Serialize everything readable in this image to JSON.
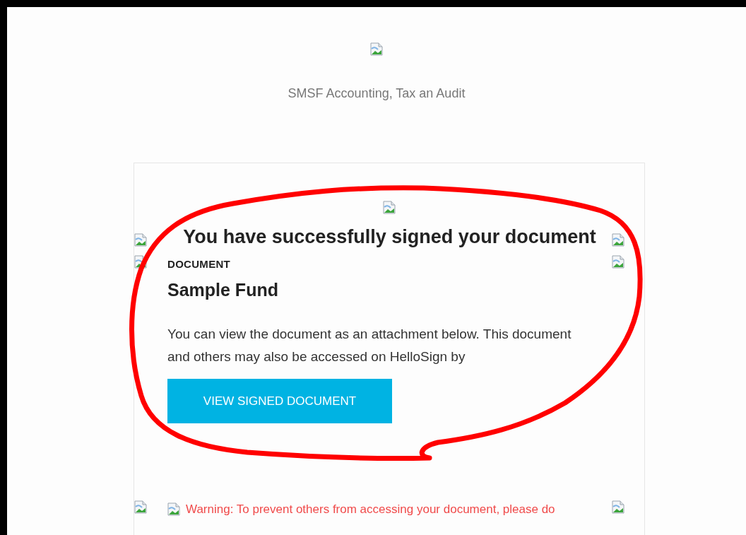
{
  "header": {
    "brand": "SMSF Accounting, Tax an Audit"
  },
  "card": {
    "heading": "You have successfully signed your document",
    "label": "DOCUMENT",
    "document_name": "Sample Fund",
    "body": "You can view the document as an attachment below. This document and others may also be accessed on HelloSign by",
    "button": "VIEW SIGNED DOCUMENT",
    "warning": "Warning: To prevent others from accessing your document, please do"
  }
}
